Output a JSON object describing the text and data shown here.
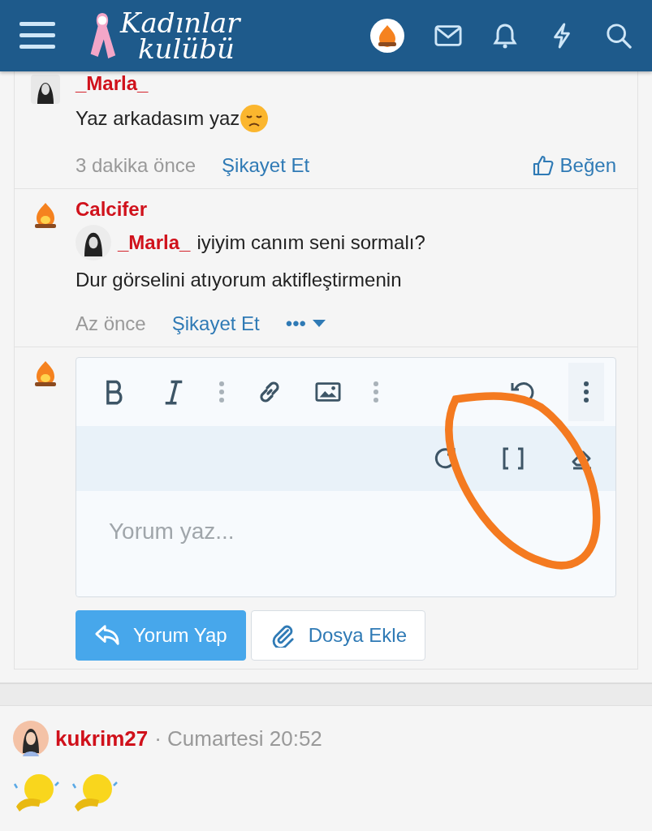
{
  "header": {
    "logo_top": "Kadınlar",
    "logo_bottom": "kulübü"
  },
  "comments": [
    {
      "kind": "plain",
      "author": "_Marla_",
      "text": "Yaz arkadasım yaz",
      "time": "3 dakika önce",
      "report": "Şikayet Et",
      "like": "Beğen"
    },
    {
      "kind": "quote",
      "author": "Calcifer",
      "quote_author": "_Marla_",
      "quote_text": "iyiyim canım seni sormalı?",
      "text": "Dur görselini atıyorum aktifleştirmenin",
      "time": "Az önce",
      "report": "Şikayet Et",
      "more": "•••"
    }
  ],
  "editor": {
    "placeholder": "Yorum yaz...",
    "submit": "Yorum Yap",
    "attach": "Dosya Ekle"
  },
  "post": {
    "author": "kukrim27",
    "time": "· Cumartesi 20:52"
  }
}
